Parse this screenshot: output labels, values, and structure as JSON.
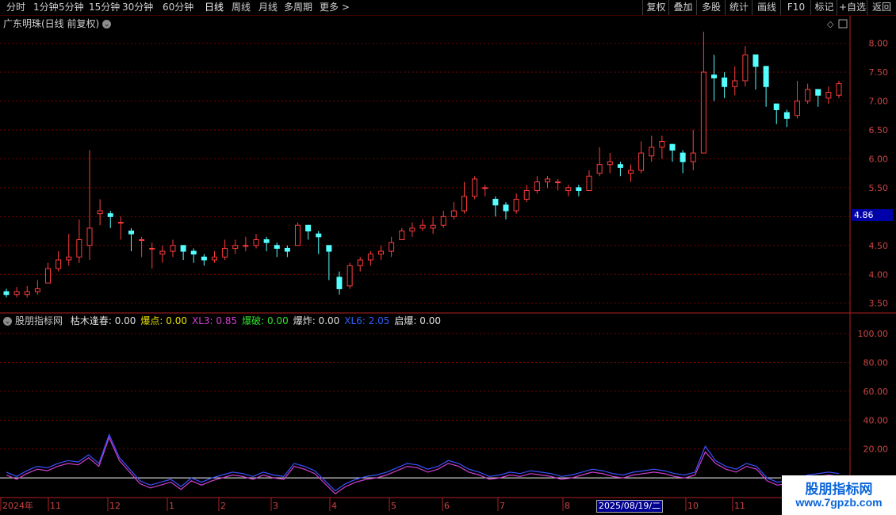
{
  "toolbar": {
    "periods": [
      "分时",
      "1分钟",
      "5分钟",
      "15分钟",
      "30分钟",
      "60分钟",
      "日线",
      "周线",
      "月线",
      "多周期",
      "更多 >"
    ],
    "active_period": "日线",
    "right_buttons": [
      "复权",
      "叠加",
      "多股",
      "统计",
      "画线",
      "F10",
      "标记",
      "+自选",
      "返回"
    ]
  },
  "main_chart": {
    "title": "广东明珠(日线 前复权)",
    "last_price_tag": "4.86",
    "y_ticks": [
      "8.00",
      "7.50",
      "7.00",
      "6.50",
      "6.00",
      "5.50",
      "5.00",
      "4.50",
      "4.00",
      "3.50"
    ]
  },
  "indicator": {
    "name": "股朋指标网",
    "fields": [
      {
        "label": "枯木逢春:",
        "value": "0.00",
        "color": "#e0e0e0"
      },
      {
        "label": "爆点:",
        "value": "0.00",
        "color": "#e8e000"
      },
      {
        "label": "XL3:",
        "value": "0.85",
        "color": "#d040d0"
      },
      {
        "label": "爆破:",
        "value": "0.00",
        "color": "#30e030"
      },
      {
        "label": "爆炸:",
        "value": "0.00",
        "color": "#e0e0e0"
      },
      {
        "label": "XL6:",
        "value": "2.05",
        "color": "#3060ff"
      },
      {
        "label": "启爆:",
        "value": "0.00",
        "color": "#e0e0e0"
      }
    ],
    "y_ticks": [
      "100.00",
      "80.00",
      "60.00",
      "40.00",
      "20.00"
    ]
  },
  "x_axis": {
    "labels": [
      "2024年",
      "11",
      "12",
      "1",
      "2",
      "3",
      "4",
      "5",
      "6",
      "7",
      "8",
      "10",
      "11"
    ],
    "highlight": "2025/08/19/二"
  },
  "watermark": {
    "title": "股朋指标网",
    "url": "www.7gpzb.com"
  },
  "colors": {
    "up": "#ff3c3c",
    "down": "#54ffff",
    "grid": "#7a0000",
    "axis": "#b02020",
    "line1": "#d040d0",
    "line2": "#3c50ff"
  },
  "chart_data": [
    {
      "type": "candlestick",
      "title": "广东明珠(日线 前复权)",
      "ylim": [
        3.4,
        8.2
      ],
      "y_ticks": [
        3.5,
        4.0,
        4.5,
        5.0,
        5.5,
        6.0,
        6.5,
        7.0,
        7.5,
        8.0
      ],
      "x_labels": [
        "2024年",
        "11",
        "12",
        "1",
        "2",
        "3",
        "4",
        "5",
        "6",
        "7",
        "8",
        "10",
        "11"
      ],
      "close": [
        3.65,
        3.7,
        3.7,
        3.75,
        4.1,
        4.25,
        4.3,
        4.6,
        4.8,
        5.1,
        5.0,
        4.9,
        4.7,
        4.6,
        4.45,
        4.4,
        4.5,
        4.4,
        4.35,
        4.25,
        4.3,
        4.45,
        4.5,
        4.5,
        4.6,
        4.55,
        4.45,
        4.4,
        4.85,
        4.75,
        4.65,
        4.4,
        3.75,
        4.15,
        4.25,
        4.35,
        4.4,
        4.55,
        4.75,
        4.8,
        4.85,
        4.85,
        5.0,
        5.1,
        5.35,
        5.65,
        5.5,
        5.2,
        5.1,
        5.3,
        5.45,
        5.6,
        5.65,
        5.6,
        5.5,
        5.45,
        5.7,
        5.9,
        5.95,
        5.85,
        5.8,
        6.1,
        6.2,
        6.3,
        6.15,
        5.95,
        6.1,
        7.5,
        7.4,
        7.25,
        7.35,
        7.8,
        7.6,
        7.25,
        6.85,
        6.7,
        7.0,
        7.2,
        7.1,
        7.15,
        7.3
      ],
      "high": [
        3.75,
        3.78,
        3.8,
        3.9,
        4.2,
        4.4,
        4.7,
        4.95,
        6.15,
        5.3,
        5.1,
        5.0,
        4.8,
        4.65,
        4.55,
        4.5,
        4.6,
        4.5,
        4.45,
        4.35,
        4.4,
        4.6,
        4.6,
        4.65,
        4.7,
        4.65,
        4.55,
        4.5,
        4.9,
        4.85,
        4.75,
        4.5,
        4.05,
        4.2,
        4.3,
        4.4,
        4.5,
        4.65,
        4.8,
        4.9,
        4.95,
        5.0,
        5.1,
        5.25,
        5.6,
        5.7,
        5.55,
        5.35,
        5.25,
        5.4,
        5.55,
        5.7,
        5.7,
        5.65,
        5.55,
        5.55,
        5.8,
        6.2,
        6.1,
        5.95,
        5.9,
        6.3,
        6.4,
        6.4,
        6.25,
        6.15,
        6.5,
        8.2,
        7.8,
        7.5,
        7.6,
        7.95,
        7.7,
        7.35,
        6.95,
        6.85,
        7.35,
        7.3,
        7.2,
        7.25,
        7.35
      ],
      "low": [
        3.6,
        3.6,
        3.6,
        3.65,
        3.85,
        4.05,
        4.15,
        4.2,
        4.25,
        4.85,
        4.8,
        4.6,
        4.4,
        4.3,
        4.1,
        4.2,
        4.3,
        4.25,
        4.2,
        4.15,
        4.2,
        4.25,
        4.35,
        4.4,
        4.45,
        4.4,
        4.3,
        4.3,
        4.5,
        4.6,
        4.35,
        3.9,
        3.65,
        3.75,
        4.05,
        4.15,
        4.25,
        4.3,
        4.6,
        4.65,
        4.75,
        4.7,
        4.8,
        4.95,
        5.05,
        5.3,
        5.35,
        5.0,
        4.95,
        5.05,
        5.25,
        5.4,
        5.5,
        5.45,
        5.35,
        5.35,
        5.45,
        5.7,
        5.75,
        5.7,
        5.6,
        5.75,
        5.95,
        6.0,
        5.95,
        5.75,
        5.8,
        6.8,
        7.0,
        7.05,
        7.1,
        7.25,
        7.2,
        6.9,
        6.6,
        6.55,
        6.7,
        6.95,
        6.9,
        6.95,
        7.05
      ],
      "open": [
        3.7,
        3.65,
        3.65,
        3.7,
        3.85,
        4.1,
        4.25,
        4.3,
        4.5,
        5.05,
        5.05,
        4.9,
        4.75,
        4.6,
        4.45,
        4.35,
        4.4,
        4.5,
        4.4,
        4.3,
        4.25,
        4.3,
        4.45,
        4.5,
        4.5,
        4.6,
        4.5,
        4.45,
        4.5,
        4.85,
        4.7,
        4.5,
        3.95,
        3.8,
        4.15,
        4.25,
        4.35,
        4.4,
        4.6,
        4.75,
        4.8,
        4.8,
        4.85,
        5.0,
        5.1,
        5.35,
        5.5,
        5.3,
        5.2,
        5.1,
        5.3,
        5.45,
        5.6,
        5.6,
        5.45,
        5.5,
        5.45,
        5.75,
        5.9,
        5.9,
        5.75,
        5.8,
        6.05,
        6.2,
        6.25,
        6.1,
        5.95,
        6.1,
        7.45,
        7.4,
        7.25,
        7.35,
        7.8,
        7.6,
        6.95,
        6.8,
        6.75,
        7.0,
        7.2,
        7.05,
        7.1
      ]
    },
    {
      "type": "line",
      "title": "股朋指标网",
      "ylim": [
        -12,
        105
      ],
      "y_ticks": [
        20,
        40,
        60,
        80,
        100
      ],
      "series": [
        {
          "name": "XL3",
          "values": [
            2,
            -1,
            3,
            6,
            5,
            8,
            10,
            9,
            14,
            8,
            28,
            12,
            4,
            -4,
            -7,
            -5,
            -3,
            -8,
            -2,
            -5,
            -2,
            0,
            2,
            1,
            -1,
            2,
            0,
            -1,
            8,
            6,
            3,
            -4,
            -11,
            -6,
            -3,
            -1,
            0,
            2,
            5,
            8,
            7,
            4,
            6,
            10,
            8,
            4,
            2,
            -1,
            0,
            2,
            1,
            3,
            2,
            1,
            -1,
            0,
            2,
            4,
            3,
            1,
            0,
            2,
            3,
            4,
            3,
            1,
            0,
            2,
            18,
            10,
            6,
            4,
            8,
            6,
            -2,
            -5,
            -4,
            -2,
            0,
            1,
            2,
            1
          ]
        },
        {
          "name": "XL6",
          "values": [
            4,
            1,
            5,
            8,
            7,
            10,
            12,
            11,
            16,
            10,
            30,
            14,
            6,
            -2,
            -5,
            -3,
            -1,
            -6,
            0,
            -3,
            0,
            2,
            4,
            3,
            1,
            4,
            2,
            1,
            10,
            8,
            5,
            -2,
            -9,
            -4,
            -1,
            1,
            2,
            4,
            7,
            10,
            9,
            6,
            8,
            12,
            10,
            6,
            4,
            1,
            2,
            4,
            3,
            5,
            4,
            3,
            1,
            2,
            4,
            6,
            5,
            3,
            2,
            4,
            5,
            6,
            5,
            3,
            2,
            4,
            22,
            12,
            8,
            6,
            10,
            8,
            0,
            -3,
            -2,
            0,
            2,
            3,
            4,
            3
          ]
        }
      ]
    }
  ]
}
